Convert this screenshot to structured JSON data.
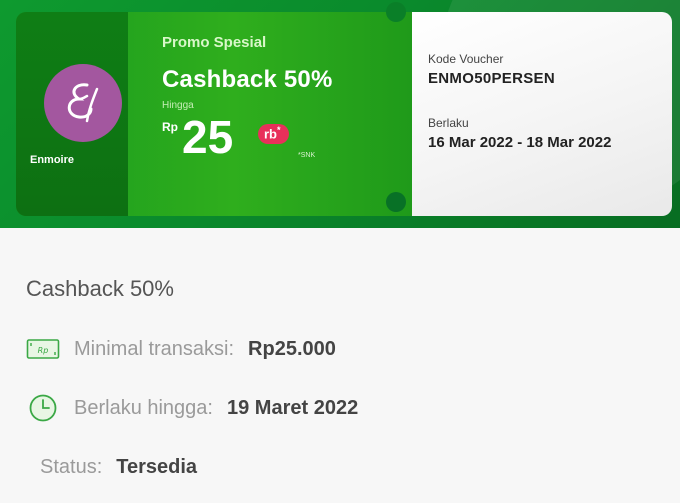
{
  "voucher": {
    "brand_name": "Enmoire",
    "promo_title": "Promo Spesial",
    "headline": "Cashback 50%",
    "upto_label": "Hingga",
    "currency": "Rp",
    "amount": "25",
    "amount_unit": "rb",
    "amount_unit_mark": "*",
    "terms_note": "*SNK",
    "code_label": "Kode Voucher",
    "code_value": "ENMO50PERSEN",
    "validity_label": "Berlaku",
    "validity_value": "16 Mar 2022 - 18 Mar 2022",
    "logo_letter": "E"
  },
  "details": {
    "title": "Cashback 50%",
    "min_transaction_label": "Minimal transaksi:",
    "min_transaction_value": "Rp25.000",
    "valid_until_label": "Berlaku hingga:",
    "valid_until_value": "19 Maret 2022",
    "status_label": "Status:",
    "status_value": "Tersedia"
  },
  "icons": {
    "money": "money-icon",
    "clock": "clock-icon"
  },
  "colors": {
    "banner_green": "#0a8a2c",
    "ticket_green": "#2fae1d",
    "accent_pink": "#e8305a",
    "logo_purple": "#a3579f",
    "icon_green": "#3aa845"
  }
}
